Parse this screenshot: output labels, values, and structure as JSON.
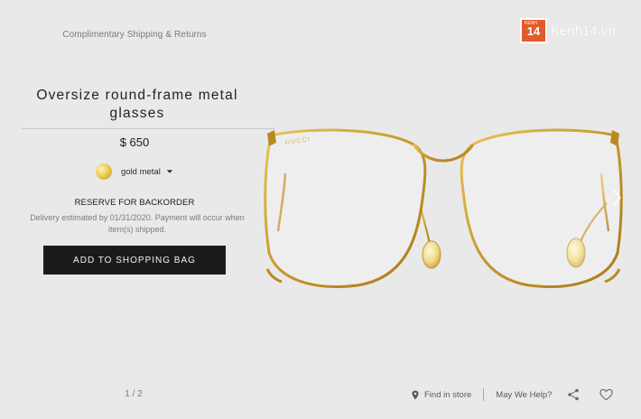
{
  "header": {
    "shipping_note": "Complimentary Shipping & Returns"
  },
  "watermark": {
    "badge": "14",
    "badge_small": "KENH",
    "text": "Kenh14.vn"
  },
  "product": {
    "title": "Oversize round-frame metal glasses",
    "price": "$ 650",
    "color": {
      "label": "gold metal",
      "swatch": "#e2c14a"
    },
    "reserve_title": "RESERVE FOR BACKORDER",
    "delivery_note": "Delivery estimated by 01/31/2020. Payment will occur when item(s) shipped.",
    "add_button_label": "ADD TO SHOPPING BAG",
    "image": {
      "brand_engraving": "GUCCI",
      "icon": "glasses-image",
      "frame_color": "#c99a2e"
    }
  },
  "gallery": {
    "pager": "1 / 2",
    "next_icon": "chevron-right-icon"
  },
  "footer": {
    "find_store": "Find in store",
    "help": "May We Help?",
    "share_icon": "share-icon",
    "wishlist_icon": "heart-icon"
  },
  "colors": {
    "background": "#e9e9e9",
    "button": "#1b1b1b",
    "text_muted": "#7a7a7a"
  }
}
